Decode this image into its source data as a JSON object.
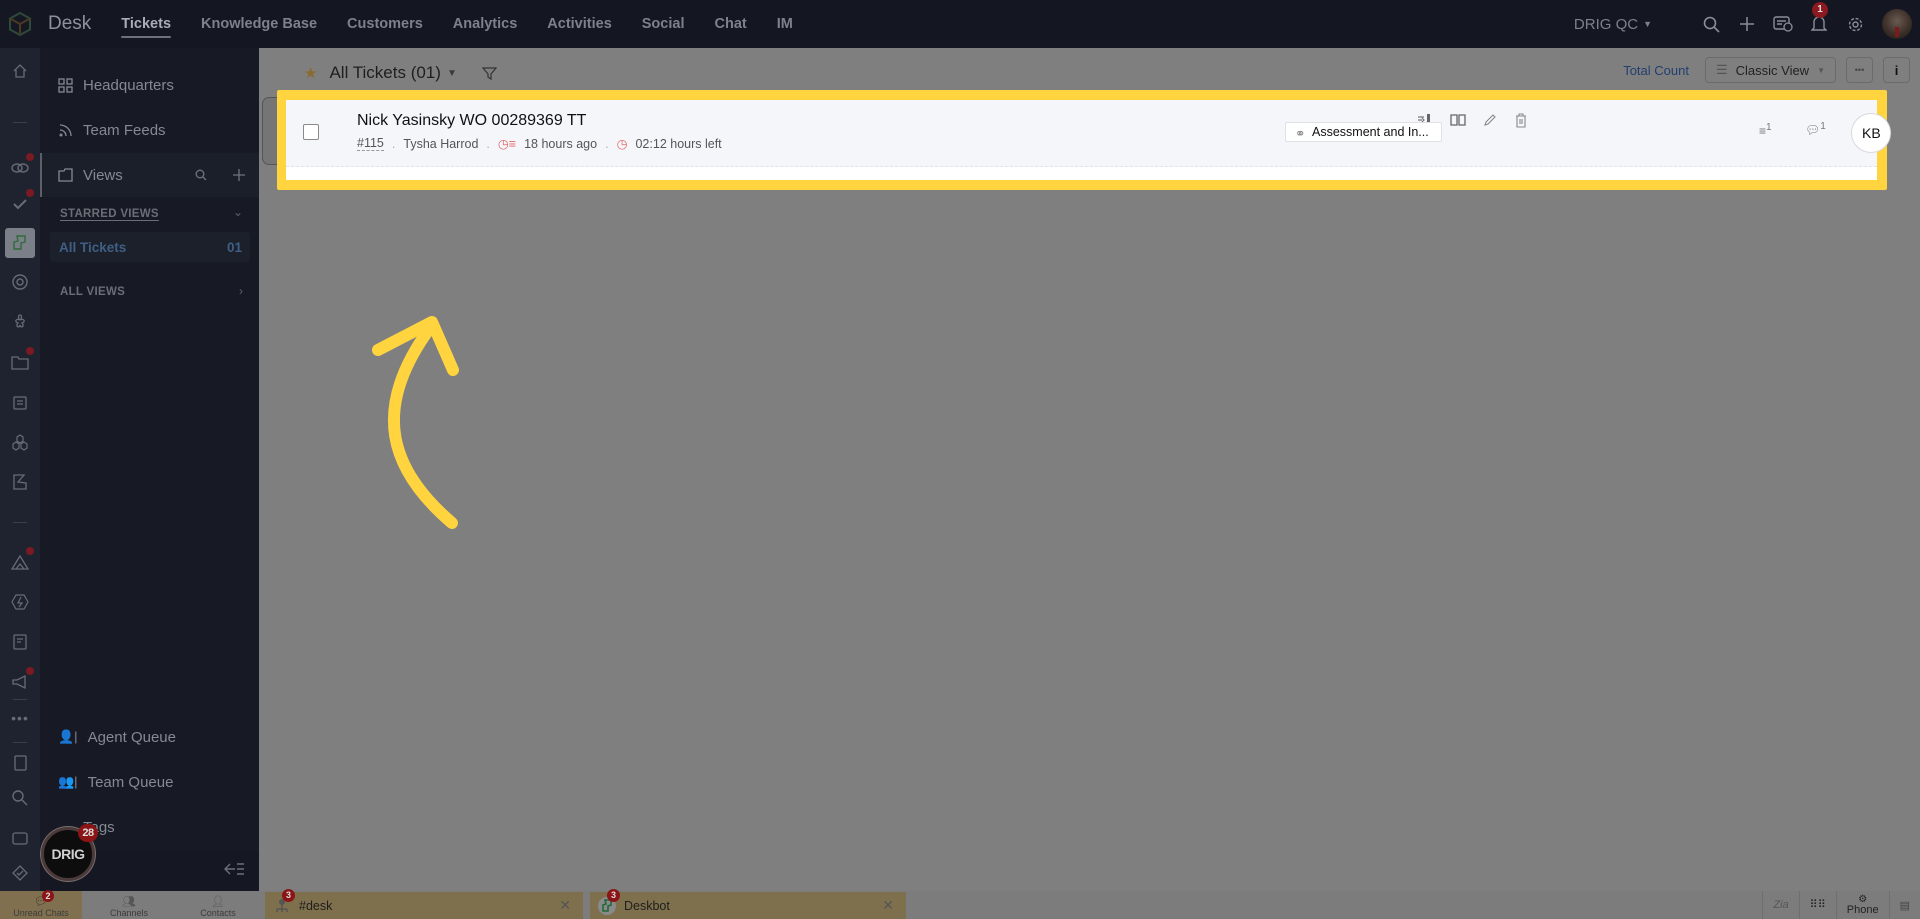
{
  "topbar": {
    "app_name": "Desk",
    "tabs": [
      {
        "label": "Tickets",
        "active": true
      },
      {
        "label": "Knowledge Base",
        "active": false
      },
      {
        "label": "Customers",
        "active": false
      },
      {
        "label": "Analytics",
        "active": false
      },
      {
        "label": "Activities",
        "active": false
      },
      {
        "label": "Social",
        "active": false
      },
      {
        "label": "Chat",
        "active": false
      },
      {
        "label": "IM",
        "active": false
      }
    ],
    "org_name": "DRIG QC",
    "notification_count": "1",
    "icons": [
      "search-icon",
      "plus-icon",
      "ticket-info-icon",
      "bell-icon",
      "gear-icon",
      "avatar"
    ]
  },
  "sidebar": {
    "items": [
      {
        "label": "Headquarters",
        "icon": "grid-icon"
      },
      {
        "label": "Team Feeds",
        "icon": "feed-icon"
      },
      {
        "label": "Views",
        "icon": "folder-icon"
      }
    ],
    "starred_views_label": "STARRED VIEWS",
    "starred_views": [
      {
        "label": "All Tickets",
        "count": "01"
      }
    ],
    "all_views_label": "ALL VIEWS",
    "bottom_items": [
      {
        "label": "Agent Queue"
      },
      {
        "label": "Team Queue"
      },
      {
        "label": "Tags"
      }
    ],
    "drig_badge": "28",
    "drig_label": "DRIG"
  },
  "main": {
    "view_title": "All Tickets (01)",
    "total_count_label": "Total Count",
    "view_mode": "Classic View",
    "ticket": {
      "subject": "Nick Yasinsky WO 00289369 TT",
      "id": "#115",
      "contact": "Tysha Harrod",
      "created": "18 hours ago",
      "due": "02:12 hours left",
      "tag": "Assessment and In...",
      "thread_count": "1",
      "comment_count": "1",
      "owner_initials": "KB"
    }
  },
  "bottombar": {
    "tabs": [
      {
        "label": "Unread Chats",
        "badge": "2"
      },
      {
        "label": "Channels"
      },
      {
        "label": "Contacts"
      }
    ],
    "chats": [
      {
        "label": "#desk",
        "badge": "3"
      },
      {
        "label": "Deskbot",
        "badge": "3"
      }
    ],
    "phone_label": "Phone"
  },
  "colors": {
    "highlight": "#ffd43f",
    "overlay": "#7f7f7f",
    "link": "#223f70",
    "badge": "#8a1a1f"
  }
}
